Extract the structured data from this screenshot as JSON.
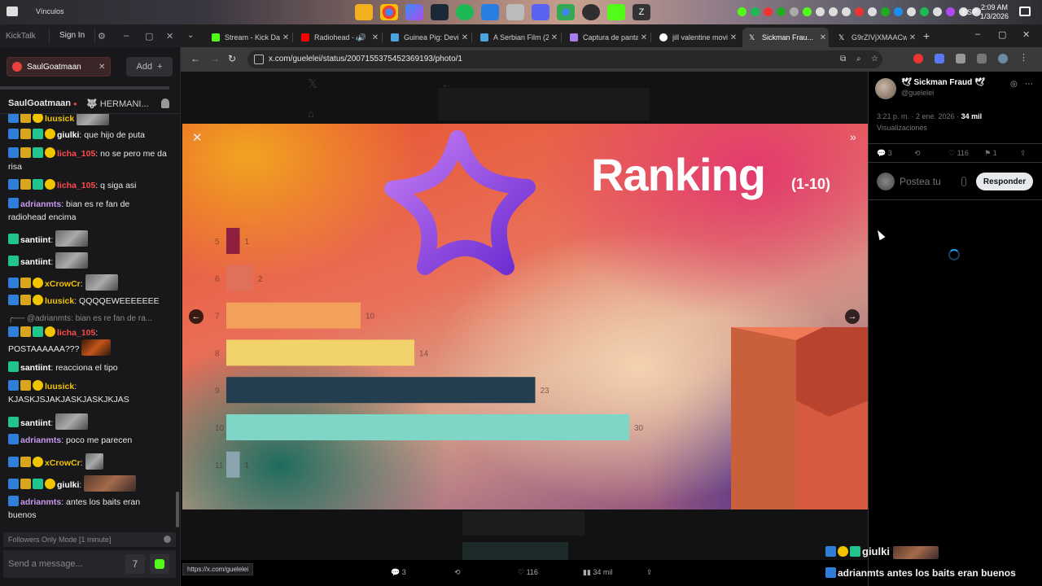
{
  "taskbar": {
    "folder_label": "Vínculos",
    "lang": "ESP",
    "time": "2:09 AM",
    "date": "1/3/2026",
    "icons": [
      "file-explorer-icon",
      "chrome-icon",
      "copilot-icon",
      "steam-icon",
      "spotify-icon",
      "app-icon",
      "files-icon",
      "discord-icon",
      "chrome-profile-icon",
      "obs-icon",
      "kick-icon",
      "z-app-icon"
    ]
  },
  "chat_app": {
    "app_name": "KickTalk",
    "sign_in": "Sign In",
    "channel_chip": "SaulGoatmaan",
    "add_label": "Add",
    "tabs": {
      "primary": "SaulGoatmaan",
      "secondary": "HERMANI..."
    },
    "messages": [
      {
        "user": "luusick",
        "text": "",
        "color": "#f2c400"
      },
      {
        "user": "giulki",
        "text": "que hijo de puta",
        "color": "#ffffff"
      },
      {
        "user": "licha_105",
        "text": "no se pero me da risa",
        "color": "#ff4a4a"
      },
      {
        "user": "licha_105",
        "text": "q siga asi",
        "color": "#ff4a4a"
      },
      {
        "user": "adrianmts",
        "text": "bian es re fan de radiohead encima",
        "color": "#c89bf0"
      },
      {
        "user": "santiint",
        "text": "",
        "color": "#ffffff"
      },
      {
        "user": "santiint",
        "text": "",
        "color": "#ffffff"
      },
      {
        "user": "xCrowCr",
        "text": "",
        "color": "#f2c400"
      },
      {
        "user": "luusick",
        "text": "QQQQEWEEEEEEE",
        "color": "#f2c400"
      },
      {
        "reply_to": "@adrianmts: bian es re fan de ra..."
      },
      {
        "user": "licha_105",
        "text": "POSTAAAAAA???",
        "color": "#ff4a4a"
      },
      {
        "user": "santiint",
        "text": "reacciona el tipo",
        "color": "#ffffff"
      },
      {
        "user": "luusick",
        "text": "KJASKJSJAKJASKJASKJKJAS",
        "color": "#f2c400"
      },
      {
        "user": "santiint",
        "text": "",
        "color": "#ffffff"
      },
      {
        "user": "adrianmts",
        "text": "poco me parecen",
        "color": "#c89bf0"
      },
      {
        "user": "xCrowCr",
        "text": "",
        "color": "#f2c400"
      },
      {
        "user": "giulki",
        "text": "",
        "color": "#ffffff"
      },
      {
        "user": "adrianmts",
        "text": "antes los baits eran buenos",
        "color": "#c89bf0"
      }
    ],
    "followers_mode": "Followers Only Mode [1 minute]",
    "send_placeholder": "Send a message..."
  },
  "browser": {
    "tabs": [
      {
        "title": "Stream - Kick Da...",
        "color": "#53fc18"
      },
      {
        "title": "Radiohead - A...",
        "color": "#ff0000"
      },
      {
        "title": "Guinea Pig: Devil...",
        "color": "#4aa3df"
      },
      {
        "title": "A Serbian Film (20...",
        "color": "#4aa3df"
      },
      {
        "title": "Captura de panta...",
        "color": "#a67cf0"
      },
      {
        "title": "jill valentine movi...",
        "color": "#ffffff"
      },
      {
        "title": "Sickman Frau...",
        "color": "#ffffff",
        "active": true
      },
      {
        "title": "G9rZIVjXMAACwj...",
        "color": "#ffffff"
      }
    ],
    "url": "x.com/guelelei/status/2007155375452369193/photo/1",
    "status_url": "https://x.com/guelelei"
  },
  "image": {
    "title": "Ranking",
    "subtitle": "(1-10)"
  },
  "chart_data": {
    "type": "bar",
    "orientation": "horizontal",
    "categories": [
      "5",
      "6",
      "7",
      "8",
      "9",
      "10",
      "11"
    ],
    "values": [
      1,
      2,
      10,
      14,
      23,
      30,
      1
    ],
    "colors": [
      "#8f1f3f",
      "#e0705a",
      "#f2a05a",
      "#f2d26a",
      "#233f4f",
      "#7fd6c6",
      "#8aa4b0"
    ],
    "title": "Ranking",
    "subtitle": "(1-10)",
    "grid": false
  },
  "post": {
    "author": "Sickman Fraud",
    "handle": "@guelelei",
    "time": "3:21 p. m. · 2 ene. 2026 ·",
    "views_count": "34 mil",
    "views_label": "Visualizaciones",
    "replies": "3",
    "likes": "116",
    "bookmarks": "1",
    "reply_placeholder": "Postea tu",
    "reply_button": "Responder"
  },
  "bottom_actions": {
    "replies": "3",
    "likes": "116",
    "views": "34 mil"
  },
  "overlay": {
    "user": "giulki",
    "user2": "adrianmts",
    "text2": "antes los baits eran buenos"
  }
}
